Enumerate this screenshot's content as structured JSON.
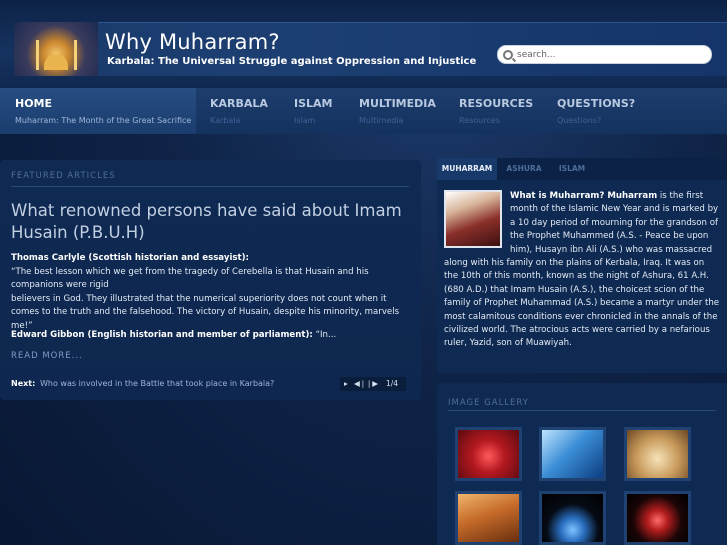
{
  "header": {
    "title": "Why Muharram?",
    "tagline": "Karbala: The Universal Struggle against Oppression and Injustice",
    "search_placeholder": "search..."
  },
  "nav": [
    {
      "label": "HOME",
      "sub": "Muharram: The Month of the Great Sacrifice",
      "active": true
    },
    {
      "label": "KARBALA",
      "sub": "Karbala"
    },
    {
      "label": "ISLAM",
      "sub": "Islam"
    },
    {
      "label": "MULTIMEDIA",
      "sub": "Multimedia"
    },
    {
      "label": "RESOURCES",
      "sub": "Resources"
    },
    {
      "label": "QUESTIONS?",
      "sub": "Questions?"
    }
  ],
  "featured": {
    "section_label": "FEATURED ARTICLES",
    "title": "What renowned persons have said about Imam Husain (P.B.U.H)",
    "quote1_author": "Thomas Carlyle (Scottish historian and essayist):",
    "quote1_text": "“The best lesson which we get from the tragedy of Cerebella is that Husain and his companions were rigid",
    "quote1_text2": "believers in God. They illustrated that the numerical superiority does not count when it comes to the truth and the falsehood. The victory of Husain, despite his minority, marvels me!”",
    "quote2_author": "Edward Gibbon (English historian and member of parliament):",
    "quote2_text": "“In...",
    "read_more": "READ MORE...",
    "next_label": "Next:",
    "next_link": "Who was involved in the Battle that took place in Karbala?",
    "pager_count": "1/4"
  },
  "tabs": {
    "items": [
      "MUHARRAM",
      "ASHURA",
      "ISLAM"
    ],
    "heading": "What is Muharram? Muharram",
    "body": "is the first month of the Islamic New Year and is marked by a 10 day period of mourning for the grandson of the Prophet Muhammed (A.S. - Peace be upon him), Husayn ibn Ali (A.S.) who was massacred along with his family on the plains of Kerbala, Iraq. It was on the 10th of this month, known as the night of Ashura, 61 A.H. (680 A.D.) that Imam Husain (A.S.), the choicest scion of the family of Prophet Muhammad (A.S.) became a martyr under the most calamitous conditions ever chronicled in the annals of the civilized world. The atrocious acts were carried by a nefarious ruler, Yazid, son of Muawiyah."
  },
  "gallery": {
    "section_label": "IMAGE GALLERY"
  },
  "colors": {
    "background": "#0f2448",
    "panel": "#0f2a52",
    "accent": "#274d82"
  }
}
